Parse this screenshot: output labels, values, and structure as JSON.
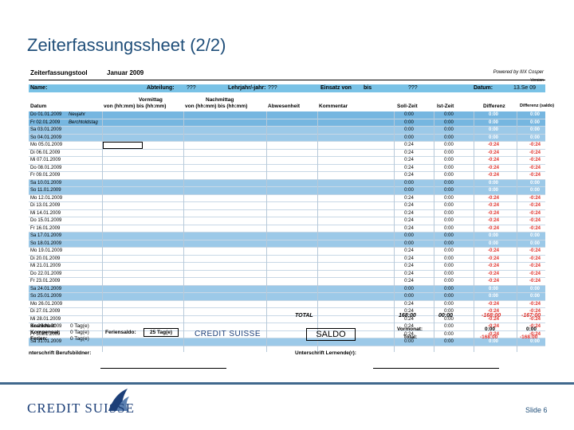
{
  "title": "Zeiterfassungssheet (2/2)",
  "sheet": {
    "tool_name": "Zeiterfassungstool",
    "month": "Januar 2009",
    "powered": "Powered by IIIX Cosper",
    "version": "Version",
    "info": {
      "name_label": "Name:",
      "abteilung_label": "Abteilung:",
      "abteilung_value": "???",
      "lehrjahr_label": "Lehrjahr/-jahr:",
      "lehrjahr_value": "???",
      "einsatz_label": "Einsatz von",
      "bis_label": "bis",
      "bis_value": "???",
      "datum_label": "Datum:",
      "datum_value": "13.Se 09"
    },
    "headers": {
      "datum": "Datum",
      "vormittag": "Vormittag",
      "vormittag_sub": "von (hh:mm) bis (hh:mm)",
      "nachmittag": "Nachmittag",
      "nachmittag_sub": "von (hh:mm) bis (hh:mm)",
      "abwesenheit": "Abwesenheit",
      "kommentar": "Kommentar",
      "soll": "Soll-Zeit",
      "ist": "Ist-Zeit",
      "differenz": "Differenz",
      "differenz2": "Differenz (saldo)"
    },
    "rows": [
      {
        "date": "Do 01.01.2009",
        "note": "Neujahr",
        "soll": "0:00",
        "ist": "0:00",
        "diff": "0:00",
        "diff2": "0:00",
        "style": "dkblue"
      },
      {
        "date": "Fr 02.01.2009",
        "note": "Berchtoldstag",
        "soll": "0:00",
        "ist": "0:00",
        "diff": "0:00",
        "diff2": "0:00",
        "style": "dkblue"
      },
      {
        "date": "Sa 03.01.2009",
        "note": "",
        "soll": "0:00",
        "ist": "0:00",
        "diff": "0:00",
        "diff2": "0:00",
        "style": "blue"
      },
      {
        "date": "So 04.01.2009",
        "note": "",
        "soll": "0:00",
        "ist": "0:00",
        "diff": "0:00",
        "diff2": "0:00",
        "style": "blue"
      },
      {
        "date": "Mo 05.01.2009",
        "note": "",
        "soll": "0:24",
        "ist": "0:00",
        "diff": "-0:24",
        "diff2": "-0:24",
        "style": ""
      },
      {
        "date": "Di 06.01.2009",
        "note": "",
        "soll": "0:24",
        "ist": "0:00",
        "diff": "-0:24",
        "diff2": "-0:24",
        "style": ""
      },
      {
        "date": "Mi 07.01.2009",
        "note": "",
        "soll": "0:24",
        "ist": "0:00",
        "diff": "-0:24",
        "diff2": "-0:24",
        "style": ""
      },
      {
        "date": "Do 08.01.2009",
        "note": "",
        "soll": "0:24",
        "ist": "0:00",
        "diff": "-0:24",
        "diff2": "-0:24",
        "style": ""
      },
      {
        "date": "Fr 09.01.2009",
        "note": "",
        "soll": "0:24",
        "ist": "0:00",
        "diff": "-0:24",
        "diff2": "-0:24",
        "style": ""
      },
      {
        "date": "Sa 10.01.2009",
        "note": "",
        "soll": "0:00",
        "ist": "0:00",
        "diff": "0:00",
        "diff2": "0:00",
        "style": "blue"
      },
      {
        "date": "So 11.01.2009",
        "note": "",
        "soll": "0:00",
        "ist": "0:00",
        "diff": "0:00",
        "diff2": "0:00",
        "style": "blue"
      },
      {
        "date": "Mo 12.01.2009",
        "note": "",
        "soll": "0:24",
        "ist": "0:00",
        "diff": "-0:24",
        "diff2": "-0:24",
        "style": ""
      },
      {
        "date": "Di 13.01.2009",
        "note": "",
        "soll": "0:24",
        "ist": "0:00",
        "diff": "-0:24",
        "diff2": "-0:24",
        "style": ""
      },
      {
        "date": "Mi 14.01.2009",
        "note": "",
        "soll": "0:24",
        "ist": "0:00",
        "diff": "-0:24",
        "diff2": "-0:24",
        "style": ""
      },
      {
        "date": "Do 15.01.2009",
        "note": "",
        "soll": "0:24",
        "ist": "0:00",
        "diff": "-0:24",
        "diff2": "-0:24",
        "style": ""
      },
      {
        "date": "Fr 16.01.2009",
        "note": "",
        "soll": "0:24",
        "ist": "0:00",
        "diff": "-0:24",
        "diff2": "-0:24",
        "style": ""
      },
      {
        "date": "Sa 17.01.2009",
        "note": "",
        "soll": "0:00",
        "ist": "0:00",
        "diff": "0:00",
        "diff2": "0:00",
        "style": "blue"
      },
      {
        "date": "So 18.01.2009",
        "note": "",
        "soll": "0:00",
        "ist": "0:00",
        "diff": "0:00",
        "diff2": "0:00",
        "style": "blue"
      },
      {
        "date": "Mo 19.01.2009",
        "note": "",
        "soll": "0:24",
        "ist": "0:00",
        "diff": "-0:24",
        "diff2": "-0:24",
        "style": ""
      },
      {
        "date": "Di 20.01.2009",
        "note": "",
        "soll": "0:24",
        "ist": "0:00",
        "diff": "-0:24",
        "diff2": "-0:24",
        "style": ""
      },
      {
        "date": "Mi 21.01.2009",
        "note": "",
        "soll": "0:24",
        "ist": "0:00",
        "diff": "-0:24",
        "diff2": "-0:24",
        "style": ""
      },
      {
        "date": "Do 22.01.2009",
        "note": "",
        "soll": "0:24",
        "ist": "0:00",
        "diff": "-0:24",
        "diff2": "-0:24",
        "style": ""
      },
      {
        "date": "Fr 23.01.2009",
        "note": "",
        "soll": "0:24",
        "ist": "0:00",
        "diff": "-0:24",
        "diff2": "-0:24",
        "style": ""
      },
      {
        "date": "Sa 24.01.2009",
        "note": "",
        "soll": "0:00",
        "ist": "0:00",
        "diff": "0:00",
        "diff2": "0:00",
        "style": "blue"
      },
      {
        "date": "So 25.01.2009",
        "note": "",
        "soll": "0:00",
        "ist": "0:00",
        "diff": "0:00",
        "diff2": "0:00",
        "style": "blue"
      },
      {
        "date": "Mo 26.01.2009",
        "note": "",
        "soll": "0:24",
        "ist": "0:00",
        "diff": "-0:24",
        "diff2": "-0:24",
        "style": ""
      },
      {
        "date": "Di 27.01.2009",
        "note": "",
        "soll": "0:24",
        "ist": "0:00",
        "diff": "-0:24",
        "diff2": "-0:24",
        "style": ""
      },
      {
        "date": "Mi 28.01.2009",
        "note": "",
        "soll": "0:24",
        "ist": "0:00",
        "diff": "-0:24",
        "diff2": "-0:24",
        "style": ""
      },
      {
        "date": "Do 29.01.2009",
        "note": "",
        "soll": "0:24",
        "ist": "0:00",
        "diff": "-0:24",
        "diff2": "-0:24",
        "style": ""
      },
      {
        "date": "Fr 30.01.2009",
        "note": "",
        "soll": "0:24",
        "ist": "0:00",
        "diff": "-0:24",
        "diff2": "-0:24",
        "style": ""
      },
      {
        "date": "Sa 31.01.2009",
        "note": "",
        "soll": "0:00",
        "ist": "0:00",
        "diff": "0:00",
        "diff2": "0:00",
        "style": "blue"
      }
    ],
    "total": {
      "label": "TOTAL",
      "soll": "168:00",
      "ist": "00:00",
      "diff": "-168:00",
      "diff2": "-167:00"
    },
    "bottom": {
      "krankheit_label": "Krankheit:",
      "krankheit_value": "0 Tag(e)",
      "kompensat_label": "Kompensat:",
      "kompensat_value": "0 Tag(e)",
      "ferien_label": "Ferien:",
      "ferien_value": "0 Tag(e)",
      "feriensaldo_label": "Feriensaldo:",
      "feriensaldo_value": "25 Tag(e)",
      "mini_logo": "CREDIT SUISSE",
      "saldo": "SALDO",
      "vormonat_label": "Vormonat:",
      "vormonat_value": "0:00",
      "vormonat_value2": "0:00",
      "total_label": "Total:",
      "total_value": "-168:00",
      "total_value2": "-168:00",
      "sig_left": "nterschrift Berufsbildner:",
      "sig_right": "Unterschrift Lernende(r):"
    }
  },
  "footer": {
    "logo": "CREDIT SUISSE",
    "slide": "Slide 6"
  },
  "colors": {
    "brand": "#1c3f78",
    "row_blue": "#9cc9e8",
    "negative": "#e0312a"
  }
}
